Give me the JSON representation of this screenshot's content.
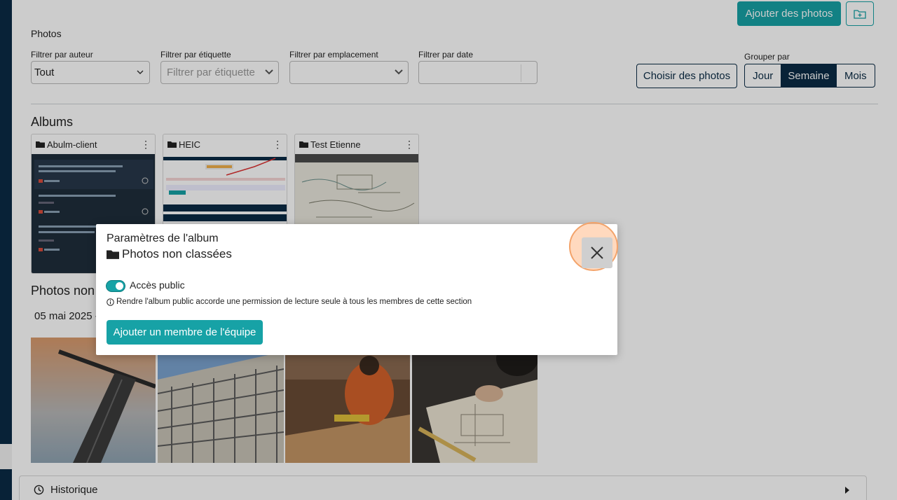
{
  "toolbar": {
    "add_photos_label": "Ajouter des photos",
    "choose_photos_label": "Choisir des photos"
  },
  "photos_header": "Photos",
  "filters": {
    "author": {
      "label": "Filtrer par auteur",
      "value": "Tout"
    },
    "tag": {
      "label": "Filtrer par étiquette",
      "placeholder": "Filtrer par étiquette"
    },
    "location": {
      "label": "Filtrer par emplacement",
      "value": ""
    },
    "date": {
      "label": "Filtrer par date",
      "value": ""
    }
  },
  "group_by": {
    "label": "Grouper par",
    "options": [
      "Jour",
      "Semaine",
      "Mois"
    ],
    "selected": "Semaine"
  },
  "albums": {
    "title": "Albums",
    "items": [
      {
        "name": "Abulm-client"
      },
      {
        "name": "HEIC"
      },
      {
        "name": "Test Etienne"
      }
    ]
  },
  "unsorted_section": {
    "title_visible": "Photos non c",
    "date_visible": "05 mai 2025 -"
  },
  "history": {
    "label": "Historique"
  },
  "modal": {
    "title": "Paramètres de l'album",
    "album_name": "Photos non classées",
    "public_toggle": {
      "label": "Accès public",
      "checked": true
    },
    "info_text": "Rendre l'album public accorde une permission de lecture seule à tous les membres de cette section",
    "add_member_label": "Ajouter un membre de l'équipe"
  },
  "colors": {
    "accent": "#17a2a6",
    "navy": "#0a2b45",
    "highlight": "#f3a36a"
  }
}
